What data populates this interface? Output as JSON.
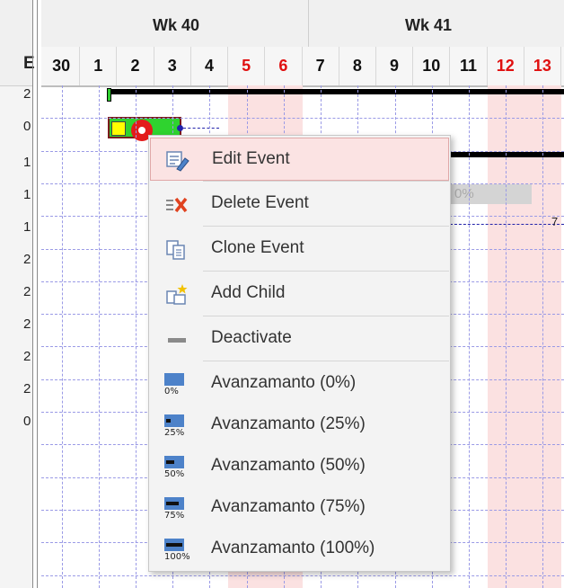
{
  "left_column": {
    "header": "E",
    "rows": [
      "2",
      "0",
      "1",
      "1",
      "1",
      "2",
      "2",
      "2",
      "2",
      "2",
      "0"
    ]
  },
  "weeks": [
    "Wk 40",
    "Wk 41"
  ],
  "days": [
    {
      "label": "30",
      "weekend": false
    },
    {
      "label": "1",
      "weekend": false
    },
    {
      "label": "2",
      "weekend": false
    },
    {
      "label": "3",
      "weekend": false
    },
    {
      "label": "4",
      "weekend": false
    },
    {
      "label": "5",
      "weekend": true
    },
    {
      "label": "6",
      "weekend": true
    },
    {
      "label": "7",
      "weekend": false
    },
    {
      "label": "8",
      "weekend": false
    },
    {
      "label": "9",
      "weekend": false
    },
    {
      "label": "10",
      "weekend": false
    },
    {
      "label": "11",
      "weekend": false
    },
    {
      "label": "12",
      "weekend": true
    },
    {
      "label": "13",
      "weekend": true
    }
  ],
  "gantt": {
    "progress_text": "0%",
    "link_text": "7"
  },
  "context_menu": {
    "items": [
      {
        "label": "Edit Event",
        "icon": "edit-event-icon",
        "highlighted": true
      },
      {
        "label": "Delete Event",
        "icon": "delete-event-icon",
        "highlighted": false
      },
      {
        "label": "Clone Event",
        "icon": "clone-event-icon",
        "highlighted": false
      },
      {
        "label": "Add Child",
        "icon": "add-child-icon",
        "highlighted": false
      },
      {
        "label": "Deactivate",
        "icon": "deactivate-icon",
        "highlighted": false
      },
      {
        "label": "Avanzamanto (0%)",
        "icon": "progress-0-icon",
        "progress": 0,
        "icon_text": "0%"
      },
      {
        "label": "Avanzamanto (25%)",
        "icon": "progress-25-icon",
        "progress": 25,
        "icon_text": "25%"
      },
      {
        "label": "Avanzamanto (50%)",
        "icon": "progress-50-icon",
        "progress": 50,
        "icon_text": "50%"
      },
      {
        "label": "Avanzamanto (75%)",
        "icon": "progress-75-icon",
        "progress": 75,
        "icon_text": "75%"
      },
      {
        "label": "Avanzamanto (100%)",
        "icon": "progress-100-icon",
        "progress": 100,
        "icon_text": "100%"
      }
    ]
  },
  "colors": {
    "weekend": "#e01010",
    "weekend_band": "#fbe1e1",
    "task_fill": "#2fd32f",
    "highlight": "#fbe3e3",
    "progress_icon": "#4d82c9"
  }
}
